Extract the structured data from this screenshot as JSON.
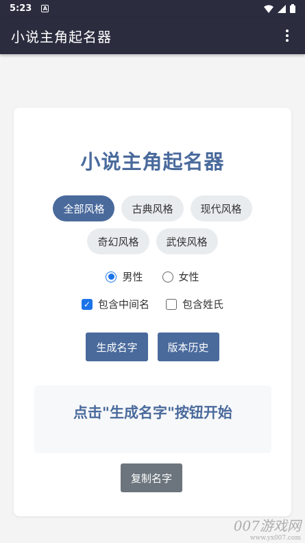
{
  "status_bar": {
    "time": "5:23",
    "notification_letter": "A"
  },
  "app_bar": {
    "title": "小说主角起名器"
  },
  "main": {
    "title": "小说主角起名器",
    "styles": [
      "全部风格",
      "古典风格",
      "现代风格",
      "奇幻风格",
      "武侠风格"
    ],
    "selected_style": "全部风格",
    "gender": {
      "male_label": "男性",
      "female_label": "女性",
      "selected": "男性"
    },
    "options": {
      "middle_name_label": "包含中间名",
      "middle_name_checked": true,
      "surname_label": "包含姓氏",
      "surname_checked": false
    },
    "buttons": {
      "generate": "生成名字",
      "history": "版本历史",
      "copy": "复制名字"
    },
    "result_text": "点击\"生成名字\"按钮开始"
  },
  "watermark": {
    "main": "007游戏网",
    "sub": "www.yx007.com"
  },
  "colors": {
    "header_bg": "#2b2d3f",
    "accent": "#4a6a9c",
    "radio_check": "#1a73e8",
    "copy_button": "#6c757d"
  }
}
